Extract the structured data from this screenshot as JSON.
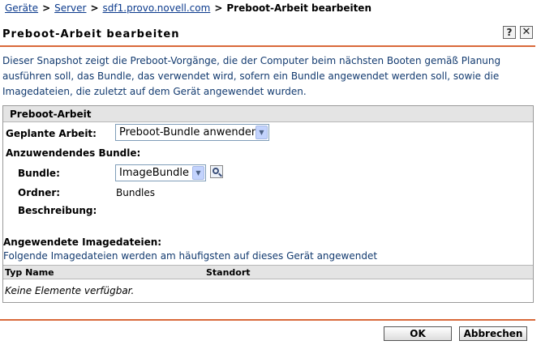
{
  "breadcrumb": {
    "items": [
      "Geräte",
      "Server",
      "sdf1.provo.novell.com"
    ],
    "current": "Preboot-Arbeit bearbeiten",
    "separator": ">"
  },
  "header": {
    "title": "Preboot-Arbeit bearbeiten",
    "help_label": "?",
    "close_label": "✕"
  },
  "description": "Dieser Snapshot zeigt die Preboot-Vorgänge, die der Computer beim nächsten Booten gemäß Planung ausführen soll, das Bundle, das verwendet wird, sofern ein Bundle angewendet werden soll, sowie die Imagedateien, die zuletzt auf dem Gerät angewendet wurden.",
  "panel": {
    "title": "Preboot-Arbeit",
    "scheduled_work_label": "Geplante Arbeit:",
    "scheduled_work_value": "Preboot-Bundle anwenden",
    "bundle_section_label": "Anzuwendendes Bundle:",
    "bundle_label": "Bundle:",
    "bundle_value": "ImageBundle",
    "folder_label": "Ordner:",
    "folder_value": "Bundles",
    "description_label": "Beschreibung:",
    "images_label": "Angewendete Imagedateien:",
    "images_desc": "Folgende Imagedateien werden am häufigsten auf dieses Gerät angewendet",
    "table": {
      "columns": [
        "Typ Name",
        "Standort"
      ],
      "empty_text": "Keine Elemente verfügbar."
    }
  },
  "buttons": {
    "ok": "OK",
    "cancel": "Abbrechen"
  },
  "colors": {
    "accent": "#d9693a",
    "link": "#0b3a8c",
    "description_text": "#123a6f",
    "header_bg": "#e4e4e4"
  }
}
